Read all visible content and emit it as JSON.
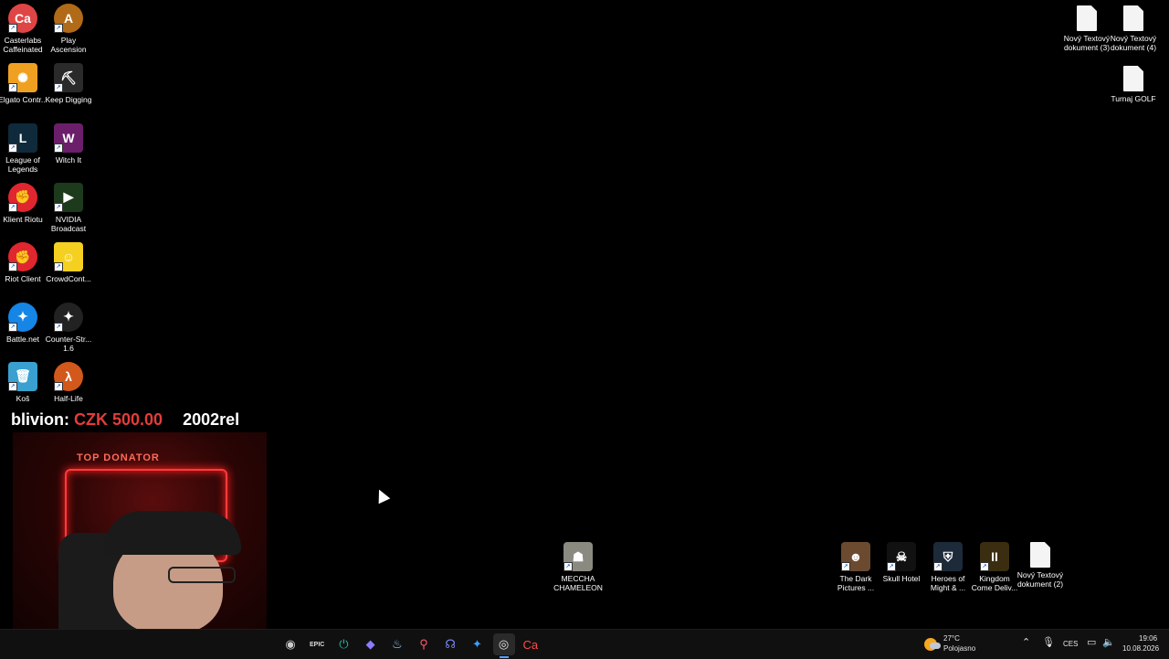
{
  "desktop": {
    "left_column_a": [
      {
        "label": "Casterlabs Caffeinated",
        "glyph": "Ca",
        "icon": "casterlabs-icon",
        "color": "#e04545",
        "round": true
      },
      {
        "label": "Elgato Contr...",
        "glyph": "✺",
        "icon": "elgato-icon",
        "color": "#f0a020",
        "round": false
      },
      {
        "label": "League of Legends",
        "glyph": "L",
        "icon": "league-icon",
        "color": "#0f2a3a",
        "round": false
      },
      {
        "label": "Klient Riotu",
        "glyph": "✊",
        "icon": "riot-icon",
        "color": "#e0262f",
        "round": true
      },
      {
        "label": "Riot Client",
        "glyph": "✊",
        "icon": "riot-icon",
        "color": "#e0262f",
        "round": true
      },
      {
        "label": "Battle.net",
        "glyph": "✦",
        "icon": "battlenet-icon",
        "color": "#1585e6",
        "round": true
      },
      {
        "label": "Koš",
        "glyph": "🗑",
        "icon": "recycle-bin-icon",
        "color": "#3aa0d0",
        "round": false
      }
    ],
    "left_column_b": [
      {
        "label": "Play Ascension",
        "glyph": "A",
        "icon": "ascension-icon",
        "color": "#b06a18",
        "round": true
      },
      {
        "label": "Keep Digging",
        "glyph": "⛏",
        "icon": "keep-digging-icon",
        "color": "#2a2a2a",
        "round": false
      },
      {
        "label": "Witch It",
        "glyph": "W",
        "icon": "witch-it-icon",
        "color": "#6b1f6b",
        "round": false
      },
      {
        "label": "NVIDIA Broadcast",
        "glyph": "▶",
        "icon": "nvidia-broadcast-icon",
        "color": "#1d3a1d",
        "round": false
      },
      {
        "label": "CrowdCont...",
        "glyph": "☺",
        "icon": "crowdcontrol-icon",
        "color": "#f5d020",
        "round": false
      },
      {
        "label": "Counter-Str... 1.6",
        "glyph": "✦",
        "icon": "counter-strike-icon",
        "color": "#222",
        "round": true
      },
      {
        "label": "Half-Life",
        "glyph": "λ",
        "icon": "half-life-icon",
        "color": "#d2581b",
        "round": true
      }
    ],
    "right_top": [
      {
        "label": "Nový Textový dokument (3)",
        "icon": "text-document-icon"
      },
      {
        "label": "Nový Textový dokument (4)",
        "icon": "text-document-icon"
      },
      {
        "label": "Turnaj GOLF",
        "icon": "text-document-icon"
      }
    ],
    "bottom_row": [
      {
        "label": "MECCHA CHAMELEON",
        "glyph": "☗",
        "icon": "meccha-chameleon-icon",
        "color": "#8a8a80"
      },
      {
        "label": "The Dark Pictures ...",
        "glyph": "☻",
        "icon": "dark-pictures-icon",
        "color": "#6b4a30"
      },
      {
        "label": "Skull Hotel",
        "glyph": "☠",
        "icon": "skull-hotel-icon",
        "color": "#111"
      },
      {
        "label": "Heroes of Might & ...",
        "glyph": "⛨",
        "icon": "heroes-icon",
        "color": "#1d2a3a"
      },
      {
        "label": "Kingdom Come Deliv...",
        "glyph": "II",
        "icon": "kingdom-come-icon",
        "color": "#3a2d10"
      },
      {
        "label": "Nový Textový dokument (2)",
        "glyph": "",
        "icon": "text-document-icon",
        "color": "#ffffff"
      }
    ]
  },
  "overlay": {
    "ticker_name": "blivion: ",
    "ticker_amount": "CZK 500.00",
    "ticker_next": "2002rel",
    "sign_text": "TOP DONATOR"
  },
  "taskbar": {
    "icons": [
      {
        "name": "obs-icon",
        "glyph": "◉",
        "color": "#ccc"
      },
      {
        "name": "epic-games-icon",
        "glyph": "EPIC",
        "color": "#ddd"
      },
      {
        "name": "power-icon",
        "glyph": "⏻",
        "color": "#20c0a0"
      },
      {
        "name": "diamond-app-icon",
        "glyph": "◆",
        "color": "#8a7dff"
      },
      {
        "name": "steam-icon",
        "glyph": "♨",
        "color": "#9ecbff"
      },
      {
        "name": "map-pin-icon",
        "glyph": "⚲",
        "color": "#ff5a6a"
      },
      {
        "name": "discord-icon",
        "glyph": "☊",
        "color": "#7d8bff"
      },
      {
        "name": "battlenet-taskbar-icon",
        "glyph": "✦",
        "color": "#3aa0ff"
      },
      {
        "name": "chrome-icon",
        "glyph": "◎",
        "color": "#e6e6e6"
      },
      {
        "name": "casterlabs-taskbar-icon",
        "glyph": "Ca",
        "color": "#ff4a4a"
      }
    ],
    "weather_temp": "27°C",
    "weather_desc": "Polojasno",
    "language": "CES",
    "time": "19:06",
    "date": "10.08.2026"
  }
}
